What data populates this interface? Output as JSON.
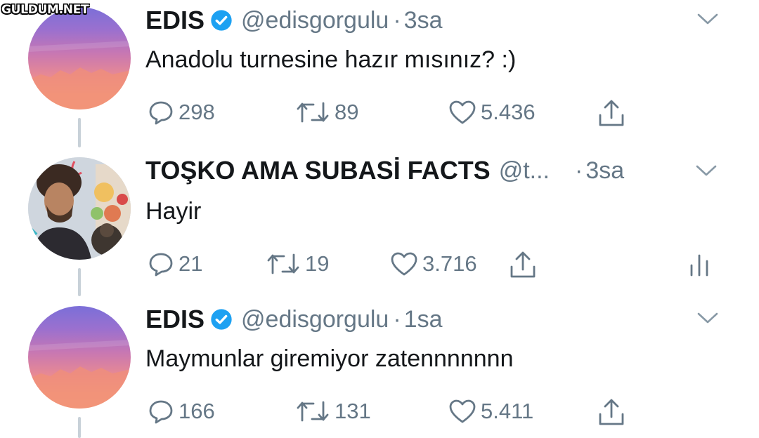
{
  "watermark": "GULDUM.NET",
  "tweets": [
    {
      "name": "EDIS",
      "handle": "@edisgorgulu",
      "time": "3sa",
      "text": "Anadolu turnesine hazır mısınız? :)",
      "replies": "298",
      "retweets": "89",
      "likes": "5.436",
      "verified": true
    },
    {
      "name": "TOŞKO AMA SUBASİ FACTS",
      "handle": "@t...",
      "time": "3sa",
      "text": "Hayir",
      "replies": "21",
      "retweets": "19",
      "likes": "3.716",
      "verified": false
    },
    {
      "name": "EDIS",
      "handle": "@edisgorgulu",
      "time": "1sa",
      "text": "Maymunlar giremiyor zatennnnnnn",
      "replies": "166",
      "retweets": "131",
      "likes": "5.411",
      "verified": true
    }
  ],
  "icons": {
    "reply": "reply-icon",
    "retweet": "retweet-icon",
    "like": "heart-icon",
    "share": "share-icon",
    "menu": "chevron-down-icon",
    "verified": "verified-badge-icon",
    "analytics": "analytics-icon"
  },
  "colors": {
    "text": "#14171a",
    "secondary": "#657786",
    "verified": "#1da1f2",
    "thread_line": "#c8d1d8"
  }
}
